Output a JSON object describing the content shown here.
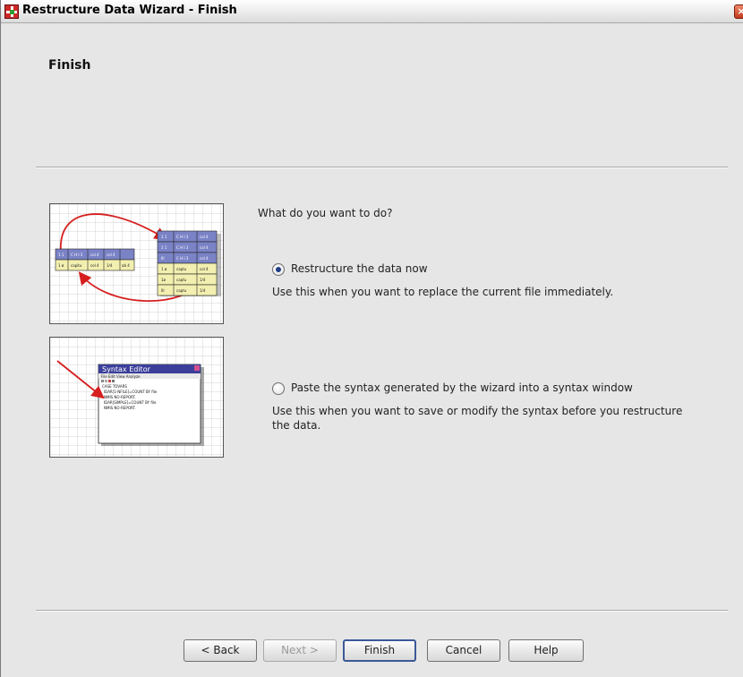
{
  "window": {
    "title": "Restructure Data Wizard - Finish"
  },
  "header": {
    "title": "Finish"
  },
  "main": {
    "prompt": "What do you want to do?",
    "options": [
      {
        "label": "Restructure the data now",
        "selected": true,
        "description": "Use this when you want to replace the current file immediately."
      },
      {
        "label": "Paste the syntax generated by the wizard into a syntax window",
        "selected": false,
        "description": "Use this when you want to save or modify the syntax before you restructure the data."
      }
    ]
  },
  "illustrations": {
    "restructure": {
      "left_table": {
        "row1": [
          "1 1",
          "C H I 3",
          "col 4",
          "col 4"
        ],
        "row2": [
          "1 ø",
          "capitu",
          "col 4",
          "1/4",
          "ab 4"
        ]
      },
      "right_table": [
        [
          "1 1",
          "C H I 3",
          "col 4"
        ],
        [
          "1 1",
          "C H I 3",
          "col 4"
        ],
        [
          "III",
          "C H I 3",
          "col 4"
        ],
        [
          "1 ø",
          "captu",
          "col 4"
        ],
        [
          "1ø",
          "captu",
          "1/4"
        ],
        [
          "III",
          "captu",
          "1/4"
        ]
      ]
    },
    "syntax": {
      "window_title": "Syntax Editor",
      "menu": "File Edit View Analyze",
      "lines": [
        "CASE TOVARS",
        "IDAR[1-NFILE]=COUNT BY file",
        "NMIS NO-REPORT.",
        "IDAR[SIMPLE]=COUNT BY file",
        "NMIS NO-REPORT."
      ]
    }
  },
  "buttons": {
    "back": "< Back",
    "next": "Next >",
    "finish": "Finish",
    "cancel": "Cancel",
    "help": "Help"
  },
  "icons": {
    "app": "spss-icon",
    "close": "close-icon"
  },
  "colors": {
    "accent": "#3b5997",
    "title_bar": "#eeeeee",
    "dialog_bg": "#e6e6e6"
  }
}
